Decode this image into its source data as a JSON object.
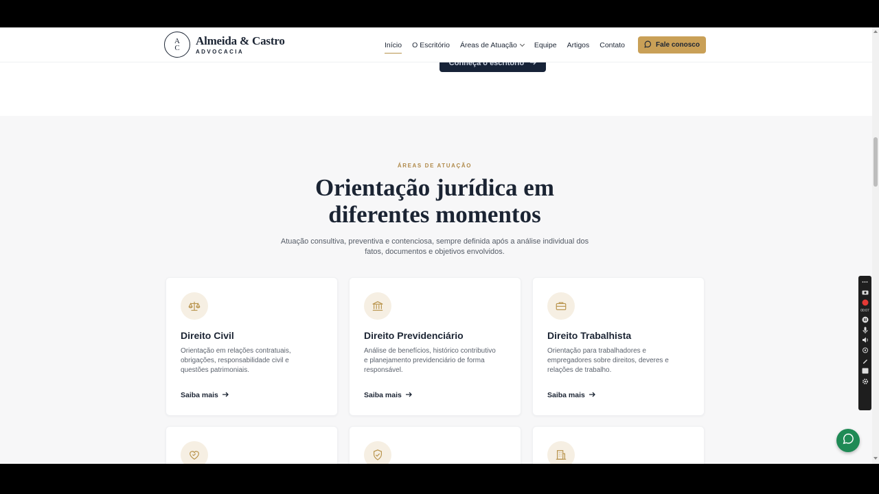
{
  "brand": {
    "name": "Almeida & Castro",
    "tagline": "ADVOCACIA",
    "monogram_top": "A",
    "monogram_bottom": "C"
  },
  "nav": {
    "items": [
      {
        "label": "Início",
        "active": true
      },
      {
        "label": "O Escritório",
        "active": false
      },
      {
        "label": "Áreas de Atuação",
        "active": false,
        "has_dropdown": true
      },
      {
        "label": "Equipe",
        "active": false
      },
      {
        "label": "Artigos",
        "active": false
      },
      {
        "label": "Contato",
        "active": false
      }
    ],
    "cta_label": "Fale conosco"
  },
  "hero": {
    "button_label": "Conheça o escritório"
  },
  "section": {
    "eyebrow": "ÁREAS DE ATUAÇÃO",
    "title_line1": "Orientação jurídica em",
    "title_line2": "diferentes momentos",
    "subtitle": "Atuação consultiva, preventiva e contenciosa, sempre definida após a análise individual dos fatos, documentos e objetivos envolvidos."
  },
  "cards": [
    {
      "icon": "scales-icon",
      "title": "Direito Civil",
      "description": "Orientação em relações contratuais, obrigações, responsabilidade civil e questões patrimoniais.",
      "link": "Saiba mais"
    },
    {
      "icon": "bank-icon",
      "title": "Direito Previdenciário",
      "description": "Análise de benefícios, histórico contributivo e planejamento previdenciário de forma responsável.",
      "link": "Saiba mais"
    },
    {
      "icon": "briefcase-icon",
      "title": "Direito Trabalhista",
      "description": "Orientação para trabalhadores e empregadores sobre direitos, deveres e relações de trabalho.",
      "link": "Saiba mais"
    }
  ],
  "cards_partial": [
    {
      "icon": "heart-handshake-icon"
    },
    {
      "icon": "shield-check-icon"
    },
    {
      "icon": "building-icon"
    }
  ],
  "recorder": {
    "time": "00:07"
  },
  "colors": {
    "navy": "#1b2433",
    "gold": "#c9a057",
    "section_bg": "#f7f7f8",
    "chat_green": "#1f8a55"
  }
}
